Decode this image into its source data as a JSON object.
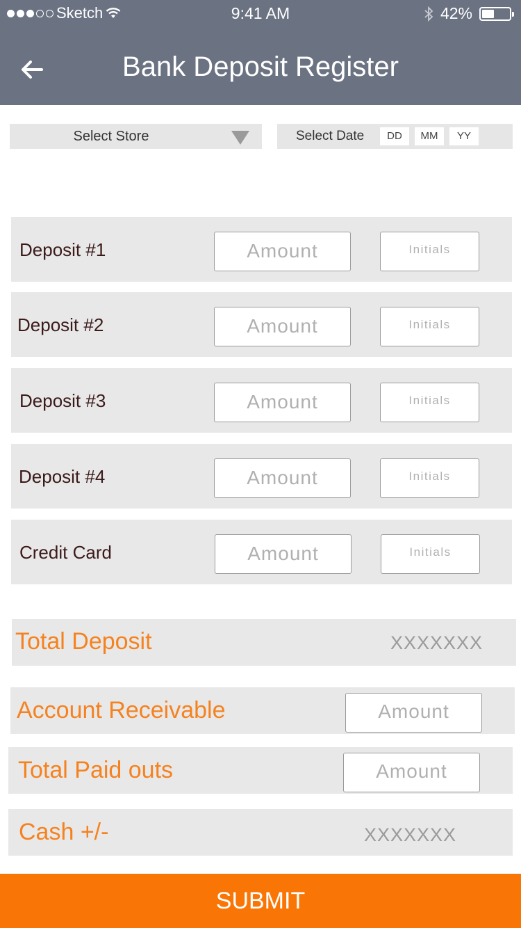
{
  "status_bar": {
    "carrier": "Sketch",
    "time": "9:41 AM",
    "battery": "42%"
  },
  "header": {
    "title": "Bank Deposit Register"
  },
  "filters": {
    "store_label": "Select Store",
    "date_label": "Select Date",
    "day_placeholder": "DD",
    "month_placeholder": "MM",
    "year_placeholder": "YY"
  },
  "deposits": [
    {
      "label": "Deposit #1",
      "amount_placeholder": "Amount",
      "initials_placeholder": "Initials"
    },
    {
      "label": "Deposit #2",
      "amount_placeholder": "Amount",
      "initials_placeholder": "Initials"
    },
    {
      "label": "Deposit #3",
      "amount_placeholder": "Amount",
      "initials_placeholder": "Initials"
    },
    {
      "label": "Deposit #4",
      "amount_placeholder": "Amount",
      "initials_placeholder": "Initials"
    },
    {
      "label": "Credit Card",
      "amount_placeholder": "Amount",
      "initials_placeholder": "Initials"
    }
  ],
  "totals": {
    "total_deposit_label": "Total Deposit",
    "total_deposit_value": "XXXXXXX",
    "account_receivable_label": "Account Receivable",
    "account_receivable_placeholder": "Amount",
    "total_paid_outs_label": "Total Paid outs",
    "total_paid_outs_placeholder": "Amount",
    "cash_label": "Cash +/-",
    "cash_value": "XXXXXXX"
  },
  "submit_label": "SUBMIT",
  "colors": {
    "header_bg": "#6b7282",
    "accent_orange": "#f97606",
    "label_orange": "#f5821f",
    "row_bg": "#e8e8e8"
  },
  "icons": {
    "back": "arrow-left-icon",
    "wifi": "wifi-icon",
    "bluetooth": "bluetooth-icon",
    "battery": "battery-icon",
    "dropdown": "caret-down-icon"
  }
}
